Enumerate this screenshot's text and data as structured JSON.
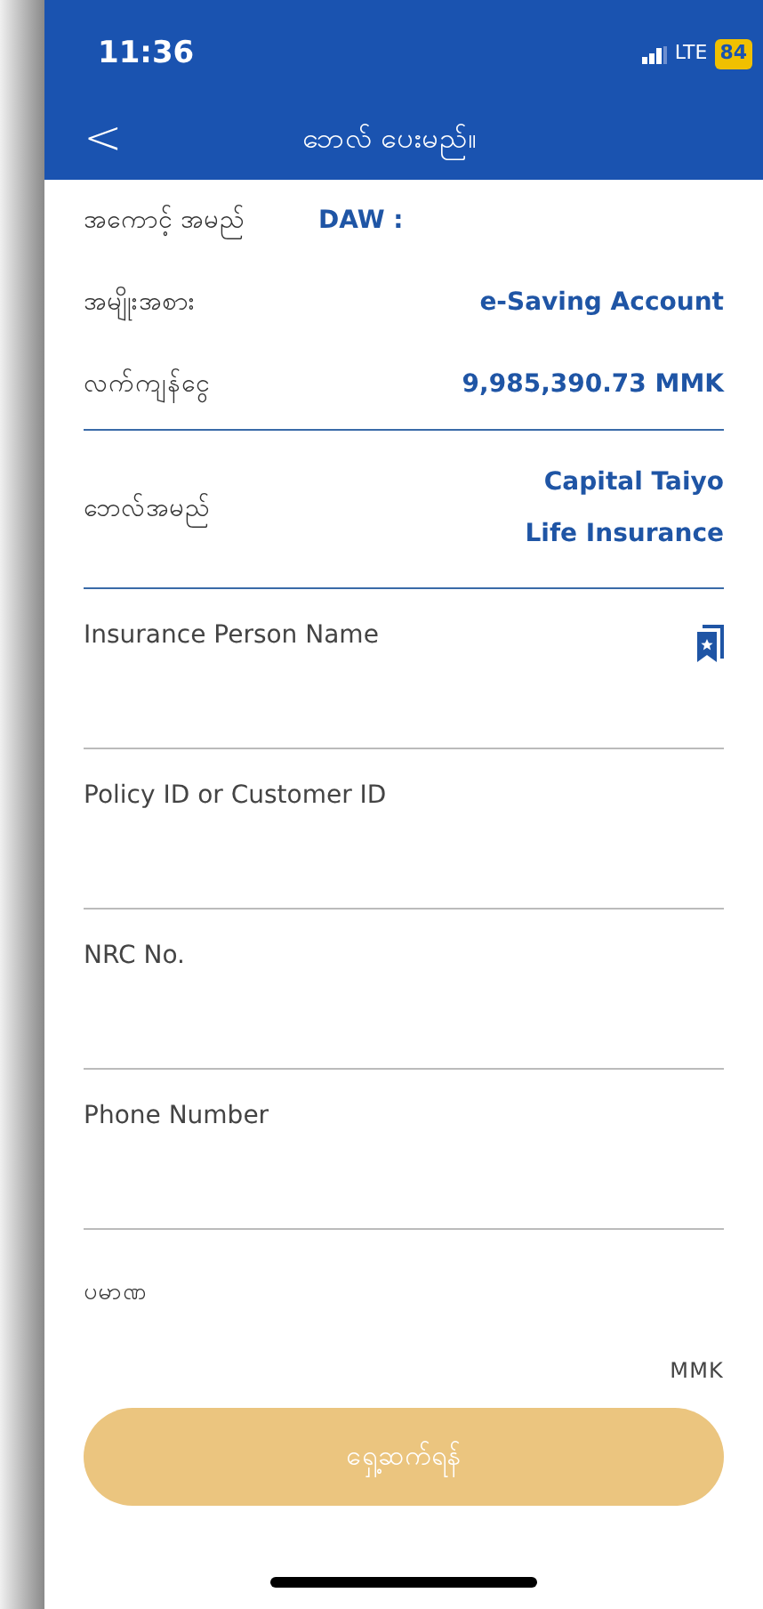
{
  "status_bar": {
    "time": "11:36",
    "network": "LTE",
    "battery": "84"
  },
  "nav": {
    "back": "<",
    "title": "ဘေလ် ပေးမည်။"
  },
  "info_rows": [
    {
      "label": "အကောင့် အမည်",
      "value": "DAW :",
      "kind": "name"
    },
    {
      "label": "အမျိုးအစား",
      "value": "e-Saving Account",
      "kind": "detail"
    },
    {
      "label": "လက်ကျန်ငွေ",
      "value": "9,985,390.73 MMK",
      "kind": "detail"
    }
  ],
  "biller": {
    "label": "ဘေလ်အမည်",
    "value_lines": [
      "Capital Taiyo",
      "Life Insurance"
    ]
  },
  "fields": [
    {
      "placeholder": "Insurance Person Name",
      "kind": "saved"
    },
    {
      "placeholder": "Policy ID or Customer ID",
      "kind": "plain"
    },
    {
      "placeholder": "NRC No.",
      "kind": "plain"
    },
    {
      "placeholder": "Phone Number",
      "kind": "plain"
    }
  ],
  "amount": {
    "label": "ပမာဏ",
    "currency": "MMK"
  },
  "button": {
    "label": "ရှေ့ဆက်ရန်",
    "disabled": true
  }
}
